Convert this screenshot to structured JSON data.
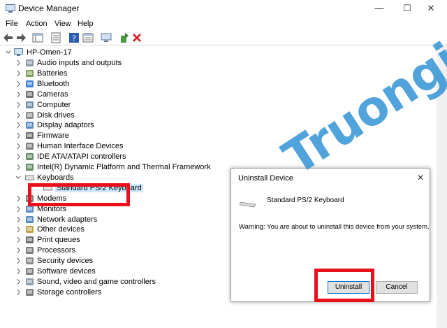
{
  "window": {
    "title": "Device Manager"
  },
  "menu": [
    "File",
    "Action",
    "View",
    "Help"
  ],
  "tree": {
    "root": "HP-Omen-17",
    "items": [
      {
        "label": "Audio inputs and outputs",
        "icon": "speaker-icon"
      },
      {
        "label": "Batteries",
        "icon": "battery-icon"
      },
      {
        "label": "Bluetooth",
        "icon": "bluetooth-icon"
      },
      {
        "label": "Cameras",
        "icon": "camera-icon"
      },
      {
        "label": "Computer",
        "icon": "computer-icon"
      },
      {
        "label": "Disk drives",
        "icon": "disk-icon"
      },
      {
        "label": "Display adaptors",
        "icon": "display-icon"
      },
      {
        "label": "Firmware",
        "icon": "firmware-icon"
      },
      {
        "label": "Human Interface Devices",
        "icon": "hid-icon"
      },
      {
        "label": "IDE ATA/ATAPI controllers",
        "icon": "ide-icon"
      },
      {
        "label": "Intel(R) Dynamic Platform and Thermal Framework",
        "icon": "chip-icon"
      },
      {
        "label": "Keyboards",
        "icon": "keyboard-icon",
        "expanded": true
      },
      {
        "label": "Standard PS/2 Keyboard",
        "icon": "keyboard-icon",
        "child": true,
        "selected": true
      },
      {
        "label": "Modems",
        "icon": "modem-icon"
      },
      {
        "label": "Monitors",
        "icon": "monitor-icon"
      },
      {
        "label": "Network adapters",
        "icon": "network-icon"
      },
      {
        "label": "Other devices",
        "icon": "other-device-icon"
      },
      {
        "label": "Print queues",
        "icon": "printer-icon"
      },
      {
        "label": "Processors",
        "icon": "processor-icon"
      },
      {
        "label": "Security devices",
        "icon": "security-icon"
      },
      {
        "label": "Software devices",
        "icon": "software-icon"
      },
      {
        "label": "Sound, video and game controllers",
        "icon": "sound-icon"
      },
      {
        "label": "Storage controllers",
        "icon": "storage-icon"
      }
    ]
  },
  "dialog": {
    "title": "Uninstall Device",
    "device_name": "Standard PS/2 Keyboard",
    "warning": "Warning: You are about to uninstall this device from your system.",
    "uninstall_label": "Uninstall",
    "cancel_label": "Cancel"
  },
  "watermark": "Truongin.top",
  "colors": {
    "highlight": "#e8101a",
    "watermark": "#2a8fd4",
    "selection": "#cce8ff"
  }
}
